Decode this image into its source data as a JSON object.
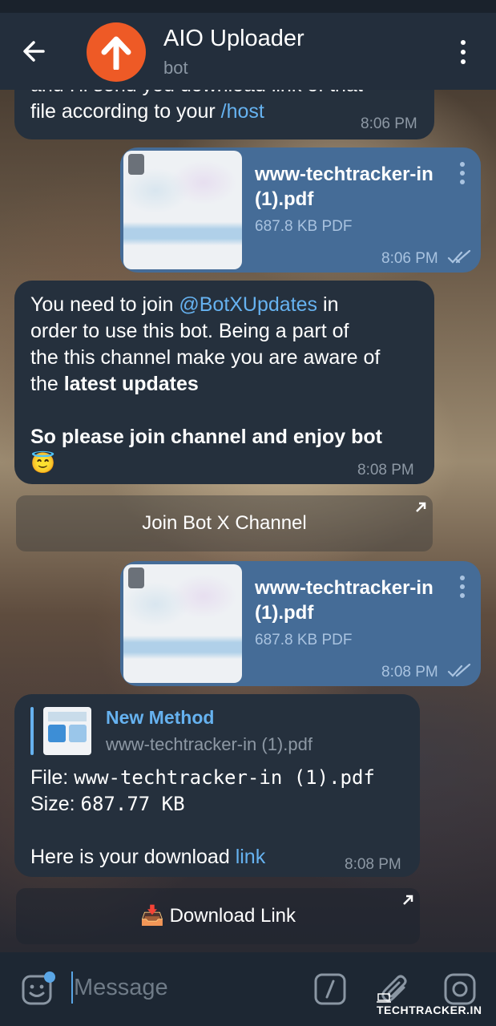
{
  "header": {
    "title": "AIO Uploader",
    "subtitle": "bot"
  },
  "messages": {
    "m1": {
      "line1": "and I'll send you download link of that",
      "line2_prefix": "file according to your ",
      "line2_link": "/host",
      "time": "8:06 PM"
    },
    "file1": {
      "name_line1": "www-techtracker-in",
      "name_line2": "(1).pdf",
      "size": "687.8 KB PDF",
      "time": "8:06 PM"
    },
    "m2": {
      "l1_prefix": "You need to join ",
      "l1_link": "@BotXUpdates",
      "l1_suffix": " in",
      "l2": "order to use this bot. Being a part of",
      "l3": "the this channel make you are aware of",
      "l4_prefix": "the ",
      "l4_bold": "latest updates",
      "l5": "So please join channel and enjoy bot",
      "emoji": "😇",
      "time": "8:08 PM"
    },
    "join_button": "Join Bot X Channel",
    "file2": {
      "name_line1": "www-techtracker-in",
      "name_line2": "(1).pdf",
      "size": "687.8 KB PDF",
      "time": "8:08 PM"
    },
    "m3": {
      "reply_title": "New Method",
      "reply_sub": "www-techtracker-in (1).pdf",
      "file_label": "File: ",
      "file_value": "www-techtracker-in (1).pdf",
      "size_label": "Size: ",
      "size_value": "687.77 KB",
      "dl_prefix": "Here is your download ",
      "dl_link": "link",
      "time": "8:08 PM"
    },
    "download_button_emoji": "📥",
    "download_button": "Download Link"
  },
  "input": {
    "placeholder": "Message"
  },
  "watermark": "TECHTRACKER.IN",
  "colors": {
    "header_bg": "#232e3c",
    "incoming_bubble": "#25303d",
    "outgoing_bubble": "#456c97",
    "link": "#66b2f0",
    "avatar": "#ee5a26"
  }
}
